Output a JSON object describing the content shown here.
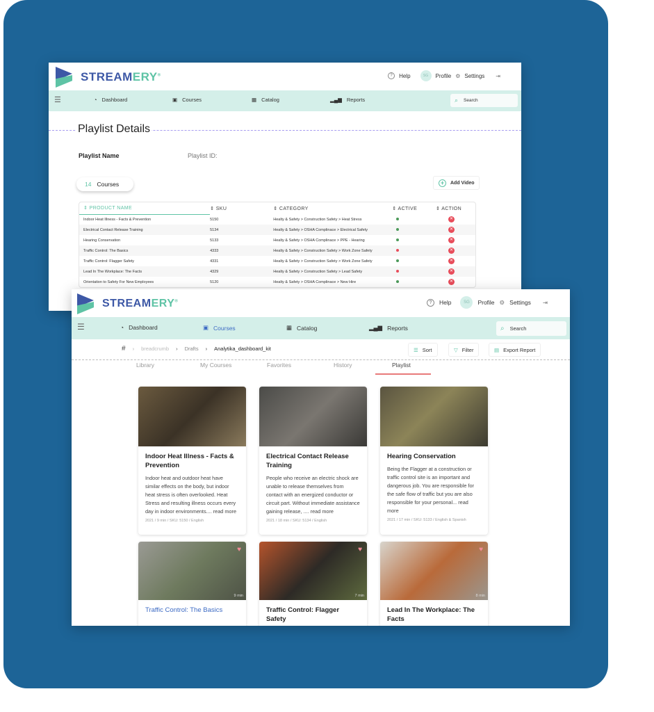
{
  "colors": {
    "background": "#1d6497",
    "brand_blue": "#3d58a6",
    "brand_green": "#5ec3a5",
    "nav_bg": "#d4efe9",
    "active_tab": "#e87a7a",
    "link_blue": "#3d6bc4",
    "delete": "#e84c5a"
  },
  "brand": {
    "name_a": "STREAM",
    "name_b": "ERY",
    "reg": "®"
  },
  "header": {
    "help": "Help",
    "avatar": "SG",
    "profile": "Profile",
    "settings": "Settings"
  },
  "nav": {
    "dashboard": "Dashboard",
    "courses": "Courses",
    "catalog": "Catalog",
    "reports": "Reports",
    "search_placeholder": "Search"
  },
  "playlist": {
    "title": "Playlist Details",
    "name_label": "Playlist Name",
    "id_label": "Playlist ID:",
    "course_count": "14",
    "course_label": "Courses",
    "add_video": "Add Video",
    "columns": [
      "PRODUCT NAME",
      "SKU",
      "CATEGORY",
      "ACTIVE",
      "ACTION"
    ],
    "rows": [
      {
        "name": "Indoor Heat Illness - Facts & Prevention",
        "sku": "5150",
        "category": "Healty & Safety > Construction Safety > Heat Stress",
        "active": true
      },
      {
        "name": "Electrical Contact Release Training",
        "sku": "5134",
        "category": "Healty & Safety > OSHA Complinace > Electrical Safety",
        "active": true
      },
      {
        "name": "Hearing Conservation",
        "sku": "5133",
        "category": "Healty & Safety > OSHA Complinace > PPE - Hearing",
        "active": true
      },
      {
        "name": "Traffic Control: The Basics",
        "sku": "4333",
        "category": "Healty & Safety > Construction Safety > Work Zone Safety",
        "active": false
      },
      {
        "name": "Traffic Control: Flagger Safety",
        "sku": "4331",
        "category": "Healty & Safety > Construction Safety > Work Zone Safety",
        "active": true
      },
      {
        "name": "Lead In The Workplace: The Facts",
        "sku": "4329",
        "category": "Healty & Safety > Construction Safety > Lead Safety",
        "active": false
      },
      {
        "name": "Orientation to Safety For New Employees",
        "sku": "5120",
        "category": "Healty & Safety > OSHA Complinace > New Hire",
        "active": true
      }
    ]
  },
  "breadcrumb": {
    "root": "#",
    "items": [
      "breadcrumb",
      "Drafts",
      "Analytika_dashboard_kit"
    ]
  },
  "toolbar": {
    "sort": "Sort",
    "filter": "Filter",
    "export": "Export Report"
  },
  "tabs": [
    "Library",
    "My Courses",
    "Favorites",
    "History",
    "Playlist"
  ],
  "active_tab": "Playlist",
  "cards": [
    {
      "title": "Indoor Heat Illness - Facts & Prevention",
      "desc": "Indoor heat and outdoor heat have similar effects on the body, but indoor heat stress is often overlooked. Heat Stress and resulting illness occurs every day in indoor environments.... read more",
      "meta": "2021 / 9 min / SKU: 5150 / English",
      "img": "linear-gradient(135deg,#6b5a3f,#3b3226 50%,#8a7a5c)"
    },
    {
      "title": "Electrical Contact Release Training",
      "desc": "People who receive an electric shock are unable to release themselves from contact with an energized conductor or circuit part. Without immediate assistance gaining release, .... read more",
      "meta": "2021 / 18 min / SKU: 5134 / English",
      "img": "linear-gradient(135deg,#4b4b48,#7a7670 50%,#3a3936)"
    },
    {
      "title": "Hearing Conservation",
      "desc": "Being the Flagger at a construction or traffic control site is an important and dangerous job. You are responsible for the safe flow of traffic but you are also responsible for your personal... read more",
      "meta": "2021 / 17 min / SKU: 5133 / English & Spanish",
      "img": "linear-gradient(135deg,#5a5440,#8c8458 45%,#3c3a30)"
    },
    {
      "title": "Traffic Control: The Basics",
      "duration": "9 min",
      "favorite": true,
      "img": "linear-gradient(135deg,#9a9a94,#6e7a5e 50%,#4e5346)",
      "highlight": true
    },
    {
      "title": "Traffic Control: Flagger Safety",
      "duration": "7 min",
      "favorite": true,
      "img": "linear-gradient(135deg,#b5542c,#2d2a26 50%,#5e6a3e)"
    },
    {
      "title": "Lead In The Workplace: The Facts",
      "duration": "8 min",
      "favorite": true,
      "img": "linear-gradient(135deg,#d8d4cc,#b96a3a 50%,#9a968e)"
    }
  ]
}
